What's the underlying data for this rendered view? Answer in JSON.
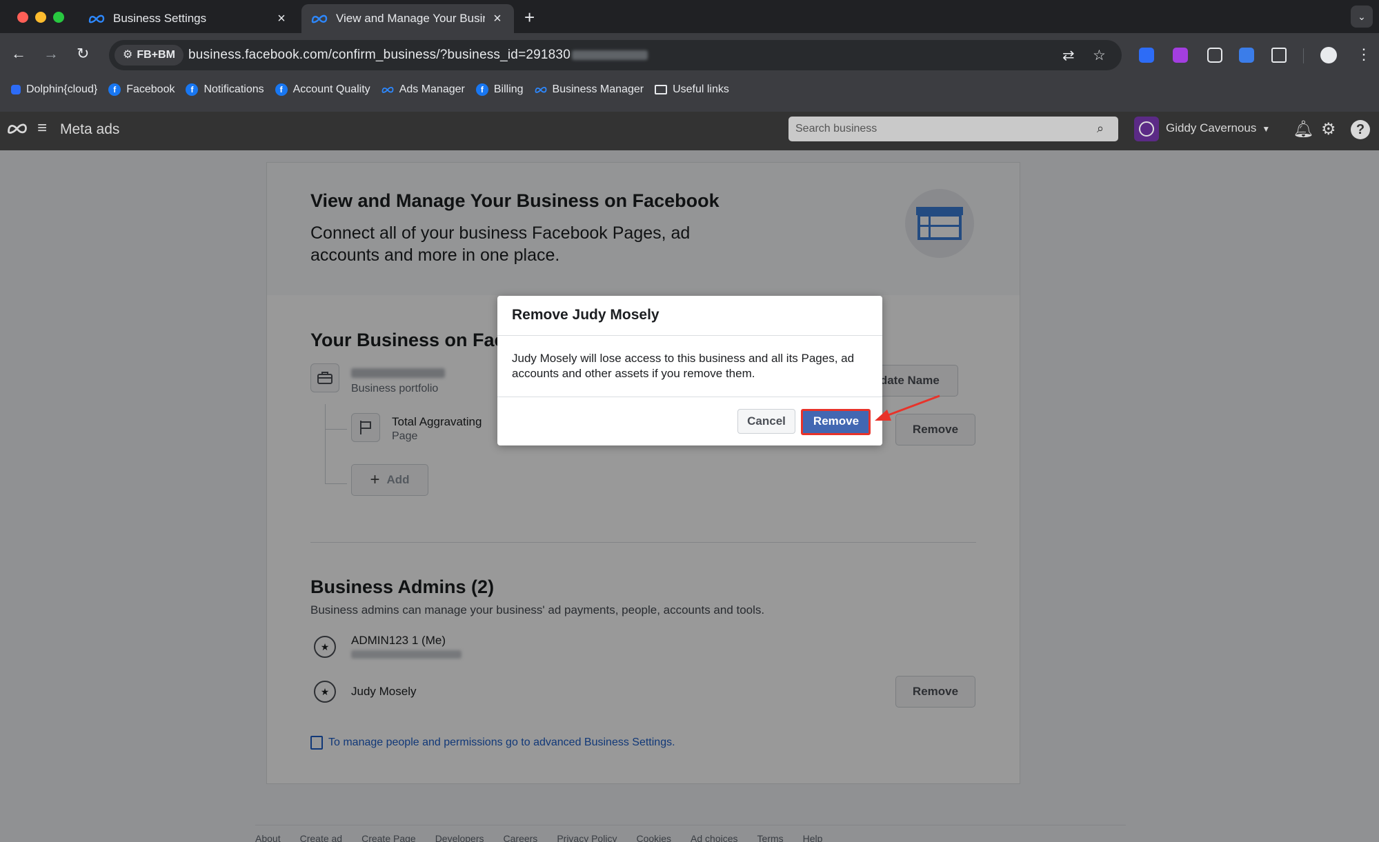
{
  "browser": {
    "tabs": [
      {
        "title": "Business Settings",
        "active": false
      },
      {
        "title": "View and Manage Your Busine",
        "active": true
      }
    ],
    "site_chip": "FB+BM",
    "url": "business.facebook.com/confirm_business/?business_id=291830",
    "bookmarks": [
      {
        "label": "Dolphin{cloud}",
        "icon": "dolphin-icon"
      },
      {
        "label": "Facebook",
        "icon": "facebook-icon"
      },
      {
        "label": "Notifications",
        "icon": "facebook-icon"
      },
      {
        "label": "Account Quality",
        "icon": "facebook-icon"
      },
      {
        "label": "Ads Manager",
        "icon": "meta-icon"
      },
      {
        "label": "Billing",
        "icon": "facebook-icon"
      },
      {
        "label": "Business Manager",
        "icon": "meta-icon"
      },
      {
        "label": "Useful links",
        "icon": "folder-icon"
      }
    ]
  },
  "meta_header": {
    "title": "Meta ads",
    "search_placeholder": "Search business",
    "user_name": "Giddy Cavernous"
  },
  "hero": {
    "title": "View and Manage Your Business on Facebook",
    "subtitle": "Connect all of your business Facebook Pages, ad accounts and more in one place."
  },
  "business_section": {
    "title": "Your Business on Fac",
    "portfolio_sub": "Business portfolio",
    "update_name_label": "Update Name",
    "page_name": "Total Aggravating",
    "page_sub": "Page",
    "remove_label": "Remove",
    "add_label": "Add"
  },
  "admins_section": {
    "title": "Business Admins (2)",
    "description": "Business admins can manage your business' ad payments, people, accounts and tools.",
    "admins": [
      {
        "name": "ADMIN123 1 (Me)"
      },
      {
        "name": "Judy Mosely",
        "remove_label": "Remove"
      }
    ],
    "advanced_link": "To manage people and permissions go to advanced Business Settings."
  },
  "footer_links": [
    "About",
    "Create ad",
    "Create Page",
    "Developers",
    "Careers",
    "Privacy Policy",
    "Cookies",
    "Ad choices",
    "Terms",
    "Help"
  ],
  "modal": {
    "title": "Remove Judy Mosely",
    "body": "Judy Mosely will lose access to this business and all its Pages, ad accounts and other assets if you remove them.",
    "cancel_label": "Cancel",
    "confirm_label": "Remove"
  },
  "colors": {
    "primary_button": "#4267b2",
    "highlight": "#e8332a",
    "link": "#1d5ec8"
  }
}
